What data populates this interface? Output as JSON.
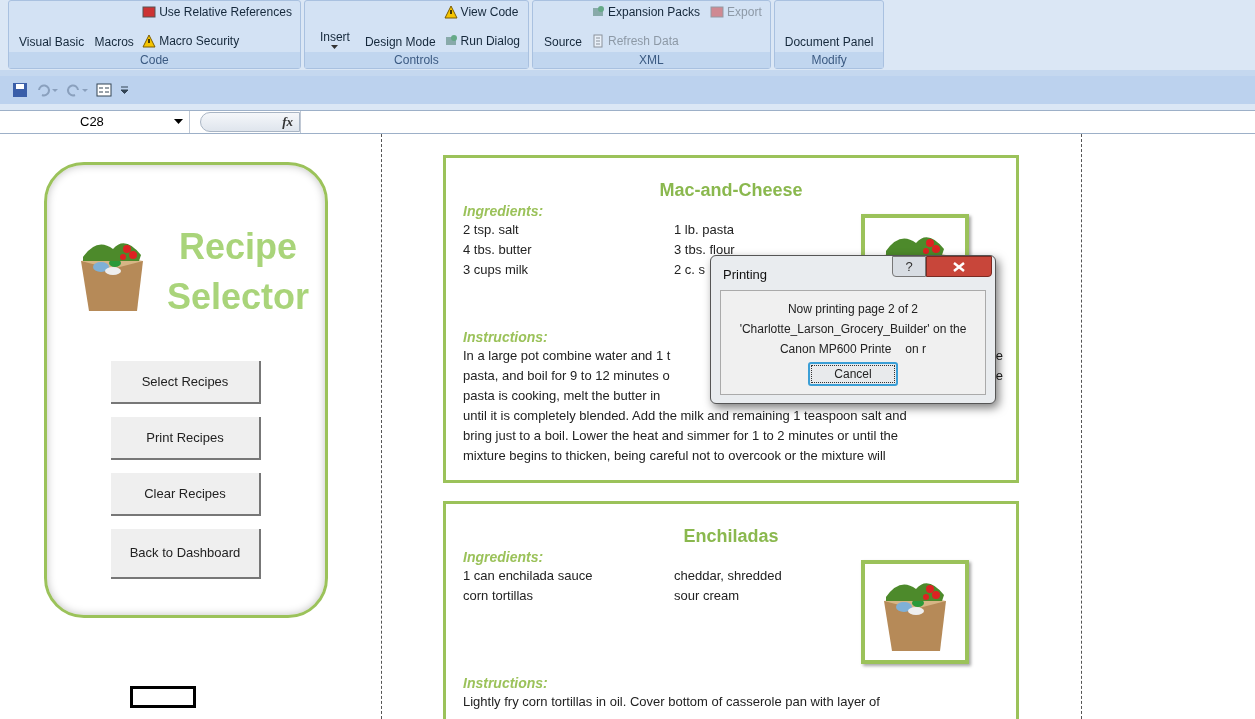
{
  "ribbon": {
    "groups": [
      {
        "label": "Code",
        "large_buttons": [
          {
            "text": "Visual Basic",
            "dropdown": false
          },
          {
            "text": "Macros",
            "dropdown": false
          }
        ],
        "small_buttons": [
          {
            "text": "Use Relative References",
            "disabled": false
          },
          {
            "text": "Macro Security",
            "disabled": false
          }
        ]
      },
      {
        "label": "Controls",
        "large_buttons": [
          {
            "text": "Insert",
            "dropdown": true
          },
          {
            "text": "Design Mode",
            "dropdown": false
          }
        ],
        "small_buttons": [
          {
            "text": "View Code",
            "disabled": false
          },
          {
            "text": "Run Dialog",
            "disabled": false
          }
        ]
      },
      {
        "label": "XML",
        "large_buttons": [
          {
            "text": "Source",
            "dropdown": false
          }
        ],
        "small_buttons": [
          {
            "text": "Expansion Packs",
            "disabled": false
          },
          {
            "text": "Refresh Data",
            "disabled": true
          },
          {
            "text": "Export",
            "disabled": true
          }
        ]
      },
      {
        "label": "Modify",
        "large_buttons": [
          {
            "text": "Document Panel",
            "dropdown": false
          }
        ]
      }
    ]
  },
  "formula_bar": {
    "name_box": "C28",
    "function_label": "fx"
  },
  "sidebar": {
    "title_lines": [
      "Recipe",
      "Selector"
    ],
    "buttons": [
      "Select Recipes",
      "Print Recipes",
      "Clear Recipes",
      "Back to Dashboard"
    ]
  },
  "recipes": [
    {
      "title": "Mac-and-Cheese",
      "ingredients_label": "Ingredients:",
      "ingredients_left": [
        "2 tsp. salt",
        "4 tbs. butter",
        "3 cups milk"
      ],
      "ingredients_right": [
        "1 lb. pasta",
        "3 tbs. flour",
        "2 c. s"
      ],
      "instructions_label": "Instructions:",
      "instruction_lines": [
        {
          "left": "In a large pot combine water and 1 t",
          "right": "e"
        },
        {
          "left": "pasta, and boil for 9 to 12 minutes o",
          "right": "e"
        },
        {
          "left": "pasta is cooking, melt the butter in"
        },
        {
          "left": "until it is completely blended. Add the milk and remaining 1 teaspoon salt and"
        },
        {
          "left": "bring just to a boil. Lower the heat and simmer for 1 to 2 minutes or until the"
        },
        {
          "left": "mixture begins to thicken, being careful not to overcook or the mixture will"
        }
      ]
    },
    {
      "title": "Enchiladas",
      "ingredients_label": "Ingredients:",
      "ingredients_left": [
        "1 can enchilada sauce",
        "corn tortillas"
      ],
      "ingredients_right": [
        "cheddar, shredded",
        "sour cream"
      ],
      "instructions_label": "Instructions:",
      "instruction_lines": [
        {
          "left": "Lightly fry corn tortillas in oil. Cover bottom of casserole pan with layer of"
        }
      ]
    }
  ],
  "dialog": {
    "title": "Printing",
    "help": "?",
    "message_lines": [
      "Now printing page 2 of 2",
      "'Charlotte_Larson_Grocery_Builder' on the"
    ],
    "printer_line": [
      "Canon MP600 Printe",
      "on r"
    ],
    "cancel": "Cancel"
  }
}
